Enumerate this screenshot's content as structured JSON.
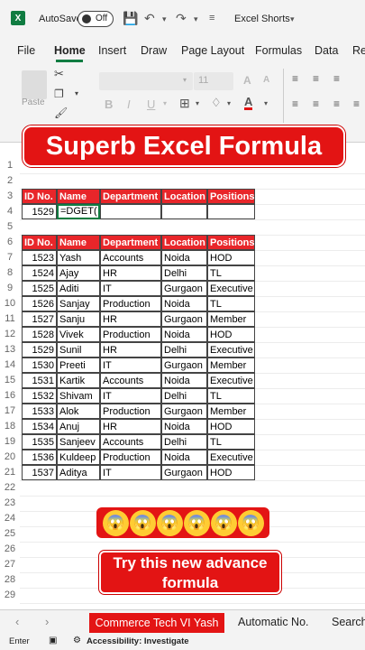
{
  "titlebar": {
    "autosave_label": "AutoSave",
    "autosave_state": "Off",
    "filename": "Excel Shorts",
    "logo": "X"
  },
  "menu": [
    "File",
    "Home",
    "Insert",
    "Draw",
    "Page Layout",
    "Formulas",
    "Data",
    "Re"
  ],
  "ribbon": {
    "paste_label": "Paste",
    "font_size": "11"
  },
  "banner": "Superb Excel Formula",
  "row_numbers": [
    "1",
    "2",
    "3",
    "4",
    "5",
    "6",
    "7",
    "8",
    "9",
    "10",
    "11",
    "12",
    "13",
    "14",
    "15",
    "16",
    "17",
    "18",
    "19",
    "20",
    "21",
    "22",
    "23",
    "24",
    "25",
    "26",
    "27",
    "28",
    "29"
  ],
  "lookup_table": {
    "headers": [
      "ID No.",
      "Name",
      "Department",
      "Location",
      "Positions"
    ],
    "id": "1529",
    "formula": "=DGET("
  },
  "data_table": {
    "headers": [
      "ID No.",
      "Name",
      "Department",
      "Location",
      "Positions"
    ],
    "rows": [
      [
        "1523",
        "Yash",
        "Accounts",
        "Noida",
        "HOD"
      ],
      [
        "1524",
        "Ajay",
        "HR",
        "Delhi",
        "TL"
      ],
      [
        "1525",
        "Aditi",
        "IT",
        "Gurgaon",
        "Executive"
      ],
      [
        "1526",
        "Sanjay",
        "Production",
        "Noida",
        "TL"
      ],
      [
        "1527",
        "Sanju",
        "HR",
        "Gurgaon",
        "Member"
      ],
      [
        "1528",
        "Vivek",
        "Production",
        "Noida",
        "HOD"
      ],
      [
        "1529",
        "Sunil",
        "HR",
        "Delhi",
        "Executive"
      ],
      [
        "1530",
        "Preeti",
        "IT",
        "Gurgaon",
        "Member"
      ],
      [
        "1531",
        "Kartik",
        "Accounts",
        "Noida",
        "Executive"
      ],
      [
        "1532",
        "Shivam",
        "IT",
        "Delhi",
        "TL"
      ],
      [
        "1533",
        "Alok",
        "Production",
        "Gurgaon",
        "Member"
      ],
      [
        "1534",
        "Anuj",
        "HR",
        "Noida",
        "HOD"
      ],
      [
        "1535",
        "Sanjeev",
        "Accounts",
        "Delhi",
        "TL"
      ],
      [
        "1536",
        "Kuldeep",
        "Production",
        "Noida",
        "Executive"
      ],
      [
        "1537",
        "Aditya",
        "IT",
        "Gurgaon",
        "HOD"
      ]
    ]
  },
  "emoji_strip": {
    "count": 6,
    "icon": "screaming-face"
  },
  "cta": {
    "line1": "Try this new advance",
    "line2": "formula"
  },
  "sheet_tabs": {
    "active": "Commerce Tech VI Yash",
    "others": [
      "Automatic No.",
      "Search"
    ]
  },
  "status": {
    "mode": "Enter",
    "accessibility": "Accessibility: Investigate"
  },
  "colors": {
    "header_red": "#e8262a",
    "banner_red": "#e31414",
    "excel_green": "#107c41"
  }
}
